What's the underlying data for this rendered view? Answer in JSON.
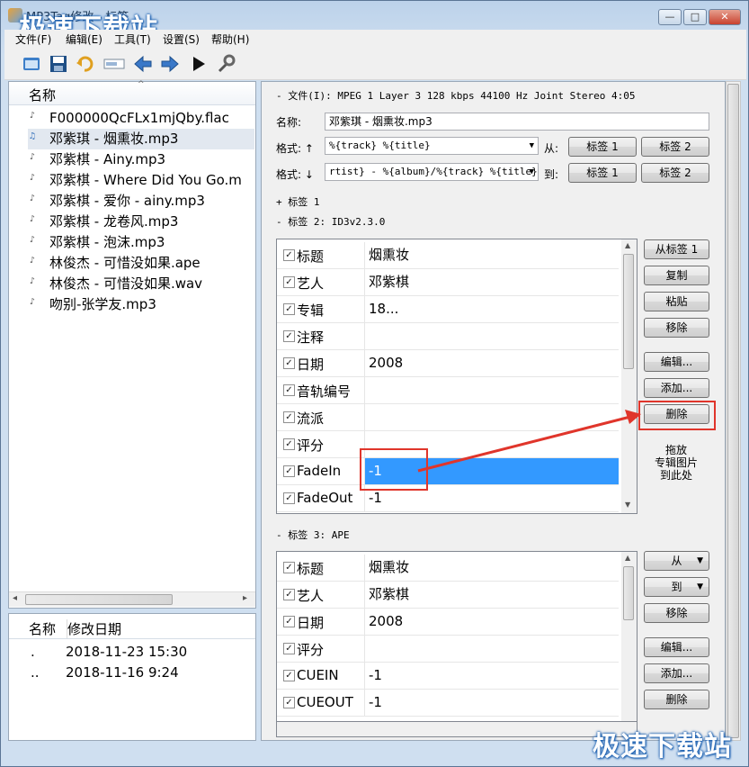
{
  "window": {
    "title": "MP3Tag修改 - 标签",
    "controls": [
      "—",
      "□",
      "✕"
    ]
  },
  "watermark": "极速下载站",
  "menu": [
    "文件(F)",
    "编辑(E)",
    "工具(T)",
    "设置(S)",
    "帮助(H)"
  ],
  "file_list": {
    "header": "名称",
    "items": [
      {
        "name": "F000000QcFLx1mjQby.flac",
        "icon": "flac-file-icon"
      },
      {
        "name": "邓紫琪 - 烟熏妆.mp3",
        "icon": "music-file-icon",
        "selected": true
      },
      {
        "name": "邓紫棋 - Ainy.mp3",
        "icon": "mp3-file-icon"
      },
      {
        "name": "邓紫棋 - Where Did You Go.m",
        "icon": "mp3-file-icon"
      },
      {
        "name": "邓紫棋 - 爱你 - ainy.mp3",
        "icon": "mp3-file-icon"
      },
      {
        "name": "邓紫棋 - 龙卷风.mp3",
        "icon": "mp3-file-icon"
      },
      {
        "name": "邓紫棋 - 泡沫.mp3",
        "icon": "mp3-file-icon"
      },
      {
        "name": "林俊杰 - 可惜没如果.ape",
        "icon": "ape-file-icon"
      },
      {
        "name": "林俊杰 - 可惜没如果.wav",
        "icon": "wav-file-icon"
      },
      {
        "name": "吻别-张学友.mp3",
        "icon": "mp3-file-icon"
      }
    ]
  },
  "dir_list": {
    "col_name": "名称",
    "col_date": "修改日期",
    "rows": [
      {
        "name": ".",
        "date": "2018-11-23 15:30"
      },
      {
        "name": "..",
        "date": "2018-11-16 9:24"
      }
    ]
  },
  "file_info": "- 文件(I): MPEG 1 Layer 3 128 kbps 44100 Hz Joint Stereo 4:05",
  "name_label": "名称:",
  "name_value": "邓紫琪 - 烟熏妆.mp3",
  "format_up_label": "格式: ↑",
  "format_up_value": "%{track} %{title}",
  "format_down_label": "格式: ↓",
  "format_down_value": "rtist} - %{album}/%{track} %{title}",
  "from_label": "从:",
  "to_label": "到:",
  "tag1_btn": "标签 1",
  "tag2_btn": "标签 2",
  "tag1_section": "+ 标签 1",
  "tag2_section": "- 标签 2: ID3v2.3.0",
  "tag3_section": "- 标签 3: APE",
  "tag2_rows": [
    {
      "key": "标题",
      "value": "烟熏妆"
    },
    {
      "key": "艺人",
      "value": "邓紫棋"
    },
    {
      "key": "专辑",
      "value": "18..."
    },
    {
      "key": "注释",
      "value": ""
    },
    {
      "key": "日期",
      "value": "2008"
    },
    {
      "key": "音轨编号",
      "value": ""
    },
    {
      "key": "流派",
      "value": ""
    },
    {
      "key": "评分",
      "value": ""
    },
    {
      "key": "FadeIn",
      "value": "-1",
      "selected": true
    },
    {
      "key": "FadeOut",
      "value": "-1"
    }
  ],
  "tag3_rows": [
    {
      "key": "标题",
      "value": "烟熏妆"
    },
    {
      "key": "艺人",
      "value": "邓紫棋"
    },
    {
      "key": "日期",
      "value": "2008"
    },
    {
      "key": "评分",
      "value": ""
    },
    {
      "key": "CUEIN",
      "value": "-1"
    },
    {
      "key": "CUEOUT",
      "value": "-1"
    }
  ],
  "tag2_buttons": [
    "从标签 1",
    "复制",
    "粘贴",
    "移除",
    "编辑...",
    "添加...",
    "删除"
  ],
  "drop_hint": "拖放\n专辑图片\n到此处",
  "tag3_buttons": [
    "从",
    "到",
    "移除",
    "编辑...",
    "添加...",
    "删除"
  ],
  "colors": {
    "accent": "#3399ff",
    "highlight": "#e0352b"
  }
}
